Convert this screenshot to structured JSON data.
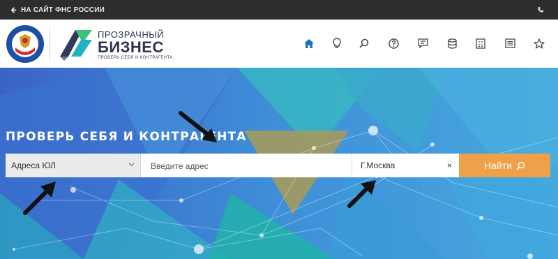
{
  "topbar": {
    "back_label": "НА САЙТ ФНС РОССИИ",
    "back_icon": "arrow-left-icon",
    "phone_icon": "phone-icon"
  },
  "header": {
    "emblem_icon": "fns-emblem-icon",
    "logo_icon": "prozrachny-biznes-logo-icon",
    "logo_line1": "ПРОЗРАЧНЫЙ",
    "logo_line2": "БИЗНЕС",
    "logo_line3": "ПРОВЕРЬ СЕБЯ И КОНТРАГЕНТА",
    "nav": [
      "home-icon",
      "lightbulb-icon",
      "search-icon",
      "question-icon",
      "chat-icon",
      "database-icon",
      "calculator-icon",
      "list-icon",
      "star-icon"
    ],
    "active_nav": "home-icon"
  },
  "hero": {
    "title": "ПРОВЕРЬ СЕБЯ И КОНТРАГЕНТА",
    "search": {
      "select_value": "Адреса ЮЛ",
      "address_placeholder": "Введите адрес",
      "city_value": "Г.Москва",
      "clear_symbol": "×",
      "button_label": "Найти"
    }
  },
  "colors": {
    "accent_orange": "#eea149",
    "hero_blue": "#3e8fd8",
    "topbar": "#2d2d2d",
    "nav_active": "#1a6fc2"
  }
}
